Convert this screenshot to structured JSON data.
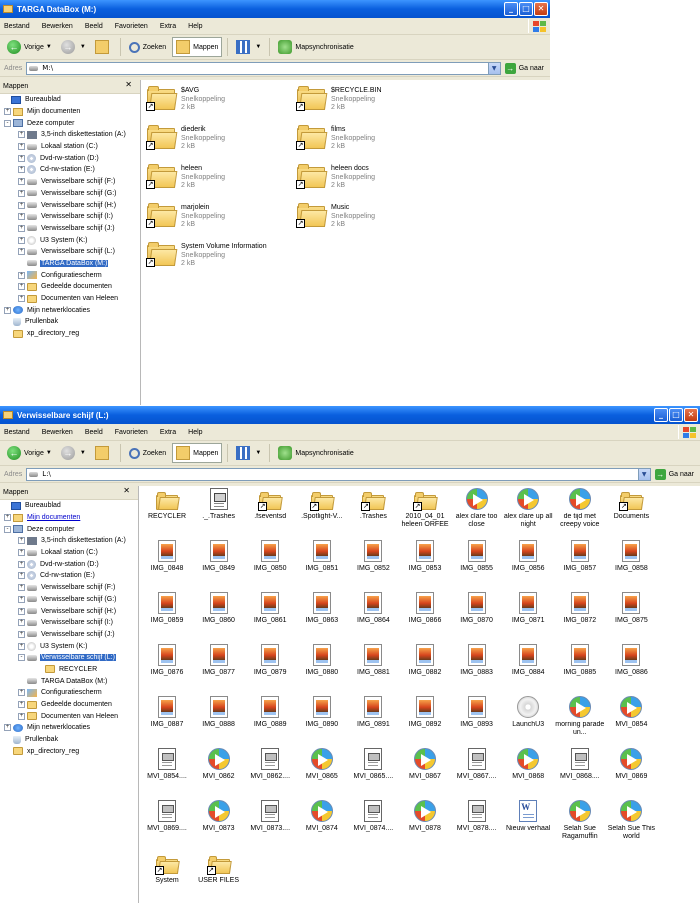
{
  "colors": {
    "title_bar": "#0a5fde",
    "selection": "#316ac5",
    "window_bg": "#ece9d8",
    "close_button": "#c23c12"
  },
  "menus": [
    "Bestand",
    "Bewerken",
    "Beeld",
    "Favorieten",
    "Extra",
    "Help"
  ],
  "toolbar": {
    "back": "Vorige",
    "search": "Zoeken",
    "folders": "Mappen",
    "sync": "Mapsynchronisatie"
  },
  "address_label": "Adres",
  "go_label": "Ga naar",
  "tree_title": "Mappen",
  "window1": {
    "title": "TARGA DataBox (M:)",
    "address": "M:\\",
    "tree": [
      {
        "label": "Bureaublad",
        "icon": "desktop-icon",
        "expander": ""
      },
      {
        "label": "Mijn documenten",
        "icon": "my-documents-icon",
        "expander": "+"
      },
      {
        "label": "Deze computer",
        "icon": "computer-icon",
        "expander": "-"
      },
      {
        "label": "3,5-inch diskettestation (A:)",
        "icon": "floppy-icon",
        "expander": "+"
      },
      {
        "label": "Lokaal station (C:)",
        "icon": "drive-icon",
        "expander": "+"
      },
      {
        "label": "Dvd-rw-station (D:)",
        "icon": "cd-drive-icon",
        "expander": "+"
      },
      {
        "label": "Cd-rw-station (E:)",
        "icon": "cd-drive-icon",
        "expander": "+"
      },
      {
        "label": "Verwisselbare schijf (F:)",
        "icon": "drive-icon",
        "expander": "+"
      },
      {
        "label": "Verwisselbare schijf (G:)",
        "icon": "drive-icon",
        "expander": "+"
      },
      {
        "label": "Verwisselbare schijf (H:)",
        "icon": "drive-icon",
        "expander": "+"
      },
      {
        "label": "Verwisselbare schijf (I:)",
        "icon": "drive-icon",
        "expander": "+"
      },
      {
        "label": "Verwisselbare schijf (J:)",
        "icon": "drive-icon",
        "expander": "+"
      },
      {
        "label": "U3 System (K:)",
        "icon": "u3-icon",
        "expander": "+"
      },
      {
        "label": "Verwisselbare schijf (L:)",
        "icon": "drive-icon",
        "expander": "+"
      },
      {
        "label": "TARGA DataBox (M:)",
        "icon": "drive-icon",
        "expander": "",
        "selected": true
      },
      {
        "label": "Configuratiescherm",
        "icon": "control-panel-icon",
        "expander": "+"
      },
      {
        "label": "Gedeelde documenten",
        "icon": "folder-icon",
        "expander": "+"
      },
      {
        "label": "Documenten van Heleen",
        "icon": "folder-icon",
        "expander": "+"
      },
      {
        "label": "Mijn netwerklocaties",
        "icon": "network-icon",
        "expander": "+"
      },
      {
        "label": "Prullenbak",
        "icon": "recycle-bin-icon",
        "expander": ""
      },
      {
        "label": "xp_directory_reg",
        "icon": "folder-icon",
        "expander": ""
      }
    ],
    "items": [
      {
        "name": "$AVG",
        "type": "Snelkoppeling",
        "size": "2 kB"
      },
      {
        "name": "$RECYCLE.BIN",
        "type": "Snelkoppeling",
        "size": "2 kB"
      },
      {
        "name": "diederik",
        "type": "Snelkoppeling",
        "size": "2 kB"
      },
      {
        "name": "films",
        "type": "Snelkoppeling",
        "size": "2 kB"
      },
      {
        "name": "heleen",
        "type": "Snelkoppeling",
        "size": "2 kB"
      },
      {
        "name": "heleen docs",
        "type": "Snelkoppeling",
        "size": "2 kB"
      },
      {
        "name": "marjolein",
        "type": "Snelkoppeling",
        "size": "2 kB"
      },
      {
        "name": "Music",
        "type": "Snelkoppeling",
        "size": "2 kB"
      },
      {
        "name": "System Volume Information",
        "type": "Snelkoppeling",
        "size": "2 kB"
      }
    ]
  },
  "window2": {
    "title": "Verwisselbare schijf (L:)",
    "address": "L:\\",
    "tree": [
      {
        "label": "Bureaublad",
        "icon": "desktop-icon",
        "expander": ""
      },
      {
        "label": "Mijn documenten",
        "icon": "my-documents-icon",
        "expander": "+",
        "link": true
      },
      {
        "label": "Deze computer",
        "icon": "computer-icon",
        "expander": "-"
      },
      {
        "label": "3,5-inch diskettestation (A:)",
        "icon": "floppy-icon",
        "expander": "+"
      },
      {
        "label": "Lokaal station (C:)",
        "icon": "drive-icon",
        "expander": "+"
      },
      {
        "label": "Dvd-rw-station (D:)",
        "icon": "cd-drive-icon",
        "expander": "+"
      },
      {
        "label": "Cd-rw-station (E:)",
        "icon": "cd-drive-icon",
        "expander": "+"
      },
      {
        "label": "Verwisselbare schijf (F:)",
        "icon": "drive-icon",
        "expander": "+"
      },
      {
        "label": "Verwisselbare schijf (G:)",
        "icon": "drive-icon",
        "expander": "+"
      },
      {
        "label": "Verwisselbare schijf (H:)",
        "icon": "drive-icon",
        "expander": "+"
      },
      {
        "label": "Verwisselbare schijf (I:)",
        "icon": "drive-icon",
        "expander": "+"
      },
      {
        "label": "Verwisselbare schijf (J:)",
        "icon": "drive-icon",
        "expander": "+"
      },
      {
        "label": "U3 System (K:)",
        "icon": "u3-icon",
        "expander": "+"
      },
      {
        "label": "Verwisselbare schijf (L:)",
        "icon": "drive-icon",
        "expander": "-",
        "selected": true
      },
      {
        "label": "RECYCLER",
        "icon": "folder-icon",
        "expander": "",
        "indent": 1
      },
      {
        "label": "TARGA DataBox (M:)",
        "icon": "drive-icon",
        "expander": ""
      },
      {
        "label": "Configuratiescherm",
        "icon": "control-panel-icon",
        "expander": "+"
      },
      {
        "label": "Gedeelde documenten",
        "icon": "folder-icon",
        "expander": "+"
      },
      {
        "label": "Documenten van Heleen",
        "icon": "folder-icon",
        "expander": "+"
      },
      {
        "label": "Mijn netwerklocaties",
        "icon": "network-icon",
        "expander": "+"
      },
      {
        "label": "Prullenbak",
        "icon": "recycle-bin-icon",
        "expander": ""
      },
      {
        "label": "xp_directory_reg",
        "icon": "folder-icon",
        "expander": ""
      }
    ],
    "items": [
      {
        "label": "RECYCLER",
        "icon": "folder"
      },
      {
        "label": "._.Trashes",
        "icon": "trashes"
      },
      {
        "label": ".fseventsd",
        "icon": "folder-shortcut"
      },
      {
        "label": ".Spotlight-V...",
        "icon": "folder-shortcut"
      },
      {
        "label": ".Trashes",
        "icon": "folder-shortcut"
      },
      {
        "label": "2010_04_01 heleen ORFEE",
        "icon": "folder-shortcut"
      },
      {
        "label": "alex clare too close",
        "icon": "media"
      },
      {
        "label": "alex clare up all night",
        "icon": "media"
      },
      {
        "label": "de tijd met creepy voice",
        "icon": "media"
      },
      {
        "label": "Documents",
        "icon": "folder-shortcut"
      },
      {
        "label": "IMG_0848",
        "icon": "image"
      },
      {
        "label": "IMG_0849",
        "icon": "image"
      },
      {
        "label": "IMG_0850",
        "icon": "image"
      },
      {
        "label": "IMG_0851",
        "icon": "image"
      },
      {
        "label": "IMG_0852",
        "icon": "image"
      },
      {
        "label": "IMG_0853",
        "icon": "image"
      },
      {
        "label": "IMG_0855",
        "icon": "image"
      },
      {
        "label": "IMG_0856",
        "icon": "image"
      },
      {
        "label": "IMG_0857",
        "icon": "image"
      },
      {
        "label": "IMG_0858",
        "icon": "image"
      },
      {
        "label": "IMG_0859",
        "icon": "image"
      },
      {
        "label": "IMG_0860",
        "icon": "image"
      },
      {
        "label": "IMG_0861",
        "icon": "image"
      },
      {
        "label": "IMG_0863",
        "icon": "image"
      },
      {
        "label": "IMG_0864",
        "icon": "image"
      },
      {
        "label": "IMG_0866",
        "icon": "image"
      },
      {
        "label": "IMG_0870",
        "icon": "image"
      },
      {
        "label": "IMG_0871",
        "icon": "image"
      },
      {
        "label": "IMG_0872",
        "icon": "image"
      },
      {
        "label": "IMG_0875",
        "icon": "image"
      },
      {
        "label": "IMG_0876",
        "icon": "image"
      },
      {
        "label": "IMG_0877",
        "icon": "image"
      },
      {
        "label": "IMG_0879",
        "icon": "image"
      },
      {
        "label": "IMG_0880",
        "icon": "image"
      },
      {
        "label": "IMG_0881",
        "icon": "image"
      },
      {
        "label": "IMG_0882",
        "icon": "image"
      },
      {
        "label": "IMG_0883",
        "icon": "image"
      },
      {
        "label": "IMG_0884",
        "icon": "image"
      },
      {
        "label": "IMG_0885",
        "icon": "image"
      },
      {
        "label": "IMG_0886",
        "icon": "image"
      },
      {
        "label": "IMG_0887",
        "icon": "image"
      },
      {
        "label": "IMG_0888",
        "icon": "image"
      },
      {
        "label": "IMG_0889",
        "icon": "image"
      },
      {
        "label": "IMG_0890",
        "icon": "image"
      },
      {
        "label": "IMG_0891",
        "icon": "image"
      },
      {
        "label": "IMG_0892",
        "icon": "image"
      },
      {
        "label": "IMG_0893",
        "icon": "image"
      },
      {
        "label": "LaunchU3",
        "icon": "cd"
      },
      {
        "label": "morning parade un...",
        "icon": "media"
      },
      {
        "label": "MVI_0854",
        "icon": "media"
      },
      {
        "label": "MVI_0854....",
        "icon": "doc"
      },
      {
        "label": "MVI_0862",
        "icon": "media"
      },
      {
        "label": "MVI_0862....",
        "icon": "doc"
      },
      {
        "label": "MVI_0865",
        "icon": "media"
      },
      {
        "label": "MVI_0865....",
        "icon": "doc"
      },
      {
        "label": "MVI_0867",
        "icon": "media"
      },
      {
        "label": "MVI_0867....",
        "icon": "doc"
      },
      {
        "label": "MVI_0868",
        "icon": "media"
      },
      {
        "label": "MVI_0868....",
        "icon": "doc"
      },
      {
        "label": "MVI_0869",
        "icon": "media"
      },
      {
        "label": "MVI_0869....",
        "icon": "doc"
      },
      {
        "label": "MVI_0873",
        "icon": "media"
      },
      {
        "label": "MVI_0873....",
        "icon": "doc"
      },
      {
        "label": "MVI_0874",
        "icon": "media"
      },
      {
        "label": "MVI_0874....",
        "icon": "doc"
      },
      {
        "label": "MVI_0878",
        "icon": "media"
      },
      {
        "label": "MVI_0878....",
        "icon": "doc"
      },
      {
        "label": "Nieuw verhaal",
        "icon": "word"
      },
      {
        "label": "Selah Sue Ragamuffin",
        "icon": "media"
      },
      {
        "label": "Selah Sue This world",
        "icon": "media"
      },
      {
        "label": "System",
        "icon": "folder-shortcut"
      },
      {
        "label": "USER FILES",
        "icon": "folder-shortcut"
      }
    ]
  }
}
